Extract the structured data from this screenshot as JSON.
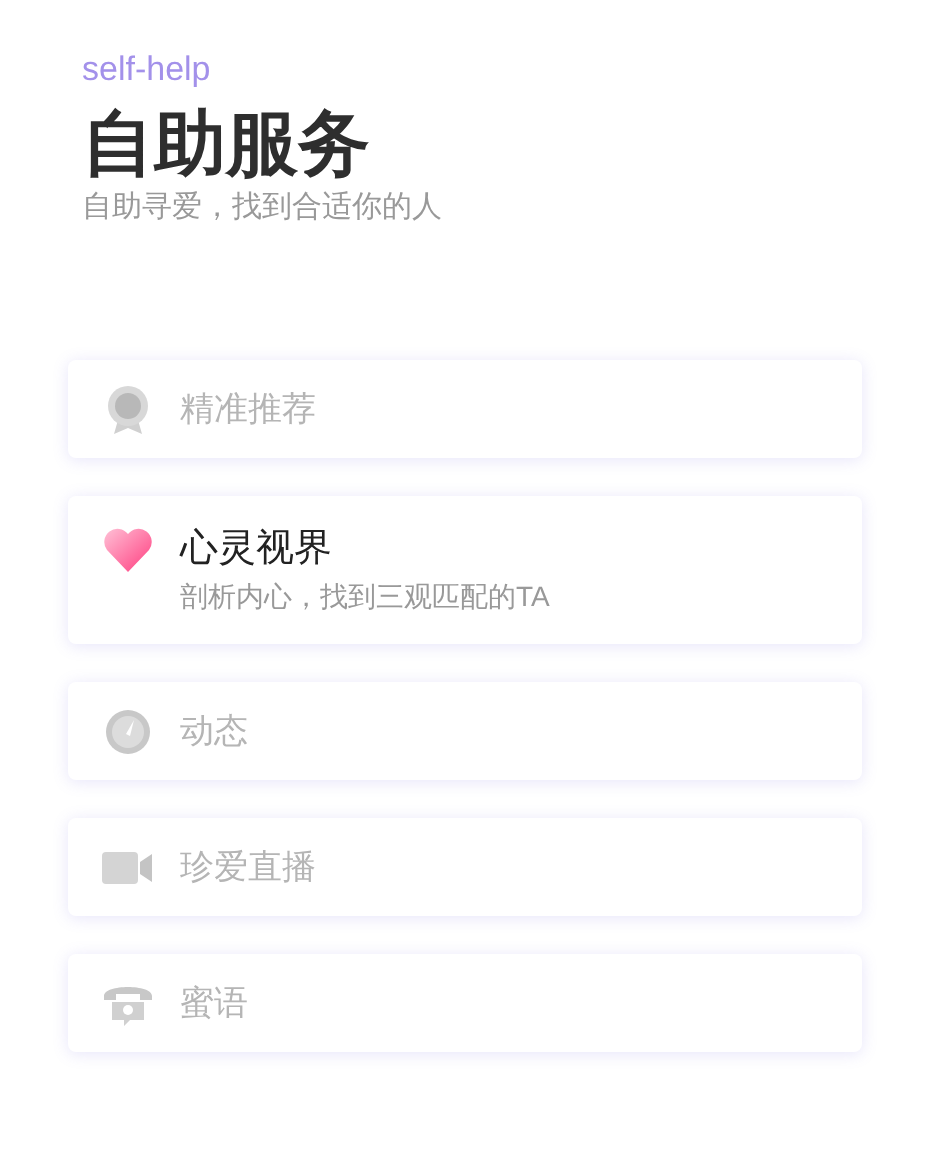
{
  "header": {
    "eyebrow": "self-help",
    "title": "自助服务",
    "subtitle": "自助寻爱，找到合适你的人"
  },
  "items": [
    {
      "kind": "medal",
      "label": "精准推荐",
      "selected": false
    },
    {
      "kind": "heart",
      "label": "心灵视界",
      "description": "剖析内心，找到三观匹配的TA",
      "selected": true
    },
    {
      "kind": "dial",
      "label": "动态",
      "selected": false
    },
    {
      "kind": "camera",
      "label": "珍爱直播",
      "selected": false
    },
    {
      "kind": "phone",
      "label": "蜜语",
      "selected": false
    }
  ]
}
